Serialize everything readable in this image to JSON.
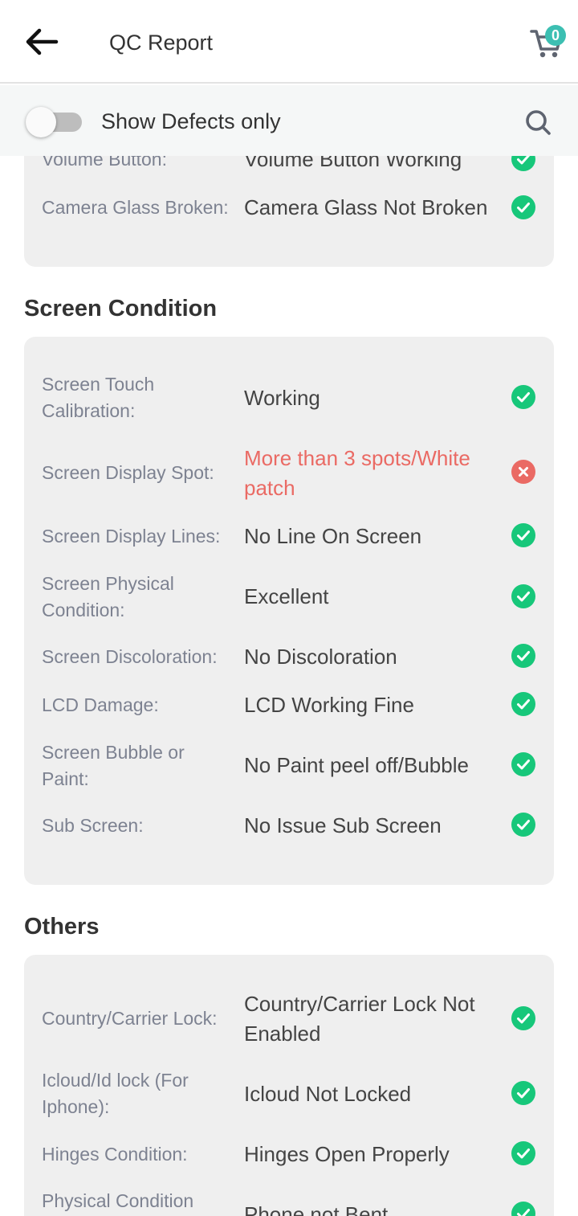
{
  "header": {
    "title": "QC Report",
    "cart_count": "0"
  },
  "filter": {
    "label": "Show Defects only",
    "enabled": false
  },
  "sections": {
    "top": {
      "rows": [
        {
          "label": "Volume Button:",
          "value": "Volume Button Working",
          "status": "ok"
        },
        {
          "label": "Camera Glass Broken:",
          "value": "Camera Glass Not Broken",
          "status": "ok"
        }
      ]
    },
    "screen": {
      "title": "Screen Condition",
      "rows": [
        {
          "label": "Screen Touch Calibration:",
          "value": "Working",
          "status": "ok"
        },
        {
          "label": "Screen Display Spot:",
          "value": "More than 3 spots/White patch",
          "status": "defect"
        },
        {
          "label": "Screen Display Lines:",
          "value": "No Line On Screen",
          "status": "ok"
        },
        {
          "label": "Screen Physical Condition:",
          "value": "Excellent",
          "status": "ok"
        },
        {
          "label": "Screen Discoloration:",
          "value": "No Discoloration",
          "status": "ok"
        },
        {
          "label": "LCD Damage:",
          "value": "LCD Working Fine",
          "status": "ok"
        },
        {
          "label": "Screen Bubble or Paint:",
          "value": "No Paint peel off/Bubble",
          "status": "ok"
        },
        {
          "label": "Sub Screen:",
          "value": "No Issue Sub Screen",
          "status": "ok"
        }
      ]
    },
    "others": {
      "title": "Others",
      "rows": [
        {
          "label": "Country/Carrier Lock:",
          "value": "Country/Carrier Lock Not Enabled",
          "status": "ok"
        },
        {
          "label": "Icloud/Id lock (For Iphone):",
          "value": "Icloud Not Locked",
          "status": "ok"
        },
        {
          "label": "Hinges Condition:",
          "value": "Hinges Open Properly",
          "status": "ok"
        },
        {
          "label": "Physical Condition",
          "value": "Phone not Bent",
          "status": "ok"
        }
      ]
    }
  },
  "colors": {
    "ok": "#17c77a",
    "defect": "#ea6a64",
    "accent": "#3cbfb2"
  }
}
